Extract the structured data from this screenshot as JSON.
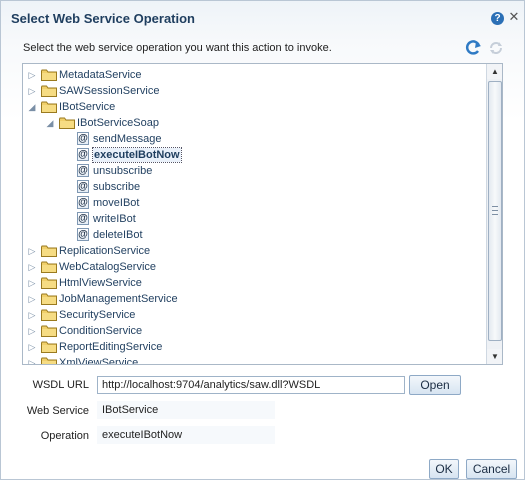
{
  "dialog": {
    "title": "Select Web Service Operation",
    "help_icon": "help-icon",
    "close_icon": "close-icon",
    "instruction": "Select the web service operation you want this action to invoke."
  },
  "toolbar": {
    "refresh_icon": "refresh-icon",
    "refresh_disabled_icon": "refresh-disabled-icon"
  },
  "tree": {
    "services_top": [
      {
        "label": "MetadataService",
        "expanded": false
      },
      {
        "label": "SAWSessionService",
        "expanded": false
      },
      {
        "label": "IBotService",
        "expanded": true
      }
    ],
    "port": {
      "label": "IBotServiceSoap",
      "expanded": true
    },
    "operations": [
      {
        "label": "sendMessage",
        "selected": false
      },
      {
        "label": "executeIBotNow",
        "selected": true
      },
      {
        "label": "unsubscribe",
        "selected": false
      },
      {
        "label": "subscribe",
        "selected": false
      },
      {
        "label": "moveIBot",
        "selected": false
      },
      {
        "label": "writeIBot",
        "selected": false
      },
      {
        "label": "deleteIBot",
        "selected": false
      }
    ],
    "services_bottom": [
      {
        "label": "ReplicationService",
        "expanded": false
      },
      {
        "label": "WebCatalogService",
        "expanded": false
      },
      {
        "label": "HtmlViewService",
        "expanded": false
      },
      {
        "label": "JobManagementService",
        "expanded": false
      },
      {
        "label": "SecurityService",
        "expanded": false
      },
      {
        "label": "ConditionService",
        "expanded": false
      },
      {
        "label": "ReportEditingService",
        "expanded": false
      },
      {
        "label": "XmlViewService",
        "expanded": false
      }
    ]
  },
  "form": {
    "wsdl_label": "WSDL URL",
    "wsdl_value": "http://localhost:9704/analytics/saw.dll?WSDL",
    "open_label": "Open",
    "web_service_label": "Web Service",
    "web_service_value": "IBotService",
    "operation_label": "Operation",
    "operation_value": "executeIBotNow"
  },
  "buttons": {
    "ok_label": "OK",
    "cancel_label": "Cancel"
  },
  "colors": {
    "accent": "#1f3e5f",
    "folder": "#e8c35a",
    "button_border": "#8ea9c6"
  }
}
